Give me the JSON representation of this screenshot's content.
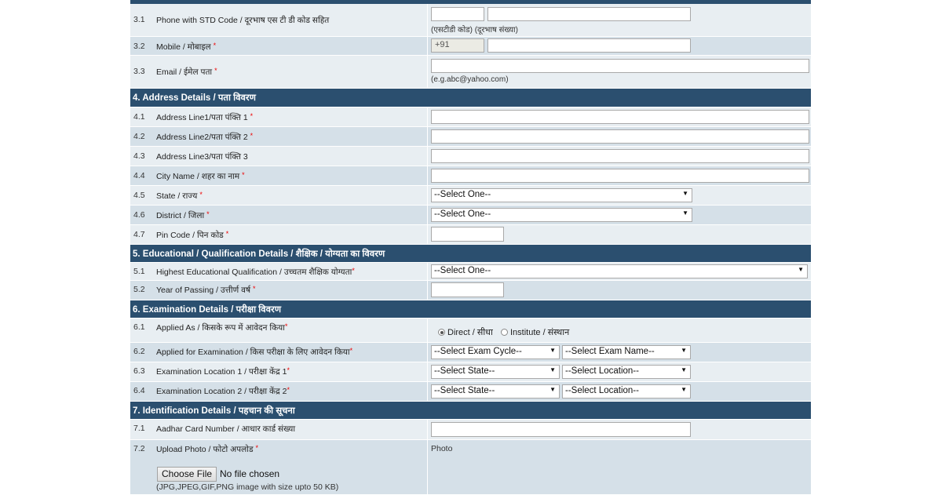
{
  "contact": {
    "phone": {
      "num": "3.1",
      "label": "Phone with STD Code / दूरभाष एस टी डी कोड सहित",
      "hint": "(एसटीडी कोड) (दूरभाष संख्या)"
    },
    "mobile": {
      "num": "3.2",
      "label": "Mobile / मोबाइल",
      "prefix": "+91"
    },
    "email": {
      "num": "3.3",
      "label": "Email / ईमेल पता",
      "hint": "(e.g.abc@yahoo.com)"
    }
  },
  "address": {
    "title": "4. Address Details / पता विवरण",
    "line1": {
      "num": "4.1",
      "label": "Address Line1/पता पंक्ति 1"
    },
    "line2": {
      "num": "4.2",
      "label": "Address Line2/पता पंक्ति 2"
    },
    "line3": {
      "num": "4.3",
      "label": "Address Line3/पता पंक्ति 3"
    },
    "city": {
      "num": "4.4",
      "label": "City Name / शहर का नाम"
    },
    "state": {
      "num": "4.5",
      "label": "State / राज्य",
      "value": "--Select One--"
    },
    "district": {
      "num": "4.6",
      "label": "District / जिला",
      "value": "--Select One--"
    },
    "pin": {
      "num": "4.7",
      "label": "Pin Code / पिन कोड"
    }
  },
  "education": {
    "title": "5. Educational / Qualification Details / शैक्षिक / योग्यता का विवरण",
    "qualification": {
      "num": "5.1",
      "label": "Highest Educational Qualification / उच्चतम शैक्षिक योग्यता",
      "value": "--Select One--"
    },
    "year": {
      "num": "5.2",
      "label": "Year of Passing / उत्तीर्ण वर्ष"
    }
  },
  "exam": {
    "title": "6. Examination Details / परीक्षा विवरण",
    "applied_as": {
      "num": "6.1",
      "label": "Applied As / किसके रूप में आवेदन किया",
      "opt1": "Direct / सीधा",
      "opt2": "Institute / संस्थान"
    },
    "applied_for": {
      "num": "6.2",
      "label": "Applied for Examination / किस परीक्षा के लिए आवेदन किया",
      "cycle": "--Select Exam Cycle--",
      "name": "--Select Exam Name--"
    },
    "loc1": {
      "num": "6.3",
      "label": "Examination Location 1 / परीक्षा केंद्र 1",
      "state": "--Select State--",
      "location": "--Select Location--"
    },
    "loc2": {
      "num": "6.4",
      "label": "Examination Location 2 / परीक्षा केंद्र 2",
      "state": "--Select State--",
      "location": "--Select Location--"
    }
  },
  "identification": {
    "title": "7. Identification Details / पहचान की सूचना",
    "aadhar": {
      "num": "7.1",
      "label": "Aadhar Card Number / आधार कार्ड संख्या"
    },
    "photo": {
      "num": "7.2",
      "label": "Upload Photo / फोटो अपलोड",
      "preview": "Photo",
      "button": "Choose File",
      "status": "No file chosen",
      "hint": "(JPG,JPEG,GIF,PNG image with size upto 50 KB)"
    }
  },
  "required_mark": "*",
  "colors": {
    "section_bg": "#2b4f6f",
    "row_light": "#e8eef2",
    "row_dark": "#d5e0e8",
    "required": "#ee0000"
  }
}
